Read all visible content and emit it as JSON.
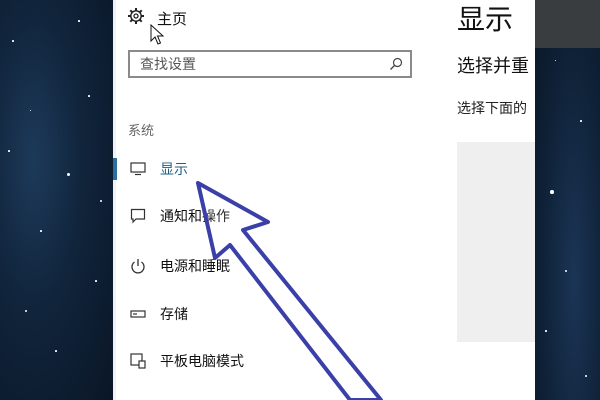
{
  "nav": {
    "home_label": "主页",
    "search_placeholder": "查找设置",
    "section_label": "系统",
    "items": [
      {
        "label": "显示",
        "icon": "monitor-icon",
        "selected": true
      },
      {
        "label": "通知和操作",
        "icon": "notification-icon",
        "selected": false
      },
      {
        "label": "电源和睡眠",
        "icon": "power-icon",
        "selected": false
      },
      {
        "label": "存储",
        "icon": "storage-icon",
        "selected": false
      },
      {
        "label": "平板电脑模式",
        "icon": "tablet-mode-icon",
        "selected": false
      }
    ]
  },
  "content": {
    "title": "显示",
    "subtitle": "选择并重",
    "description": "选择下面的"
  },
  "colors": {
    "accent": "#1f5f86",
    "annotation_arrow": "#3b3fa8"
  }
}
